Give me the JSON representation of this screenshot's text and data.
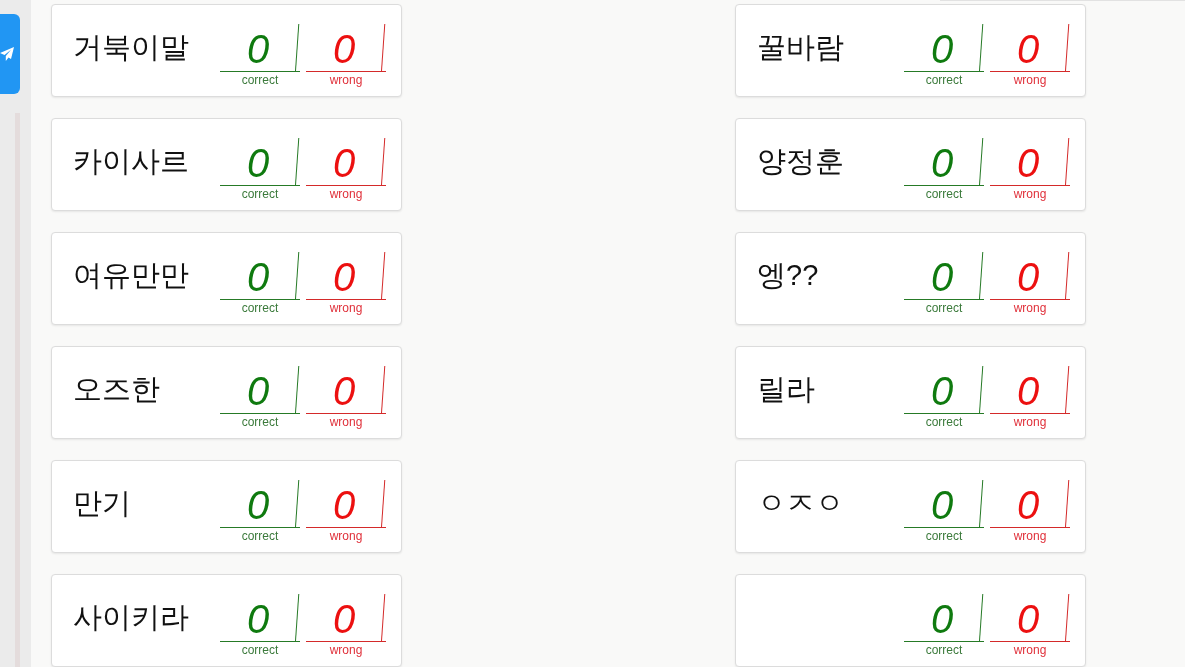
{
  "players": [
    {
      "name": "거북이말",
      "scores": [
        {
          "kind": "correct",
          "value": "0",
          "label": "correct"
        },
        {
          "kind": "wrong",
          "value": "0",
          "label": "wrong"
        }
      ]
    },
    {
      "name": "꿀바람",
      "scores": [
        {
          "kind": "correct",
          "value": "0",
          "label": "correct"
        },
        {
          "kind": "wrong",
          "value": "0",
          "label": "wrong"
        }
      ]
    },
    {
      "name": "카이사르",
      "scores": [
        {
          "kind": "correct",
          "value": "0",
          "label": "correct"
        },
        {
          "kind": "wrong",
          "value": "0",
          "label": "wrong"
        }
      ]
    },
    {
      "name": "양정훈",
      "scores": [
        {
          "kind": "correct",
          "value": "0",
          "label": "correct"
        },
        {
          "kind": "wrong",
          "value": "0",
          "label": "wrong"
        }
      ]
    },
    {
      "name": "여유만만",
      "scores": [
        {
          "kind": "correct",
          "value": "0",
          "label": "correct"
        },
        {
          "kind": "wrong",
          "value": "0",
          "label": "wrong"
        }
      ]
    },
    {
      "name": "엥??",
      "scores": [
        {
          "kind": "correct",
          "value": "0",
          "label": "correct"
        },
        {
          "kind": "wrong",
          "value": "0",
          "label": "wrong"
        }
      ]
    },
    {
      "name": "오즈한",
      "scores": [
        {
          "kind": "correct",
          "value": "0",
          "label": "correct"
        },
        {
          "kind": "wrong",
          "value": "0",
          "label": "wrong"
        }
      ]
    },
    {
      "name": "릴라",
      "scores": [
        {
          "kind": "correct",
          "value": "0",
          "label": "correct"
        },
        {
          "kind": "wrong",
          "value": "0",
          "label": "wrong"
        }
      ]
    },
    {
      "name": "만기",
      "scores": [
        {
          "kind": "correct",
          "value": "0",
          "label": "correct"
        },
        {
          "kind": "wrong",
          "value": "0",
          "label": "wrong"
        }
      ]
    },
    {
      "name": "ㅇㅈㅇ",
      "scores": [
        {
          "kind": "correct",
          "value": "0",
          "label": "correct"
        },
        {
          "kind": "wrong",
          "value": "0",
          "label": "wrong"
        }
      ]
    },
    {
      "name": "사이키라",
      "scores": [
        {
          "kind": "correct",
          "value": "0",
          "label": "correct"
        },
        {
          "kind": "wrong",
          "value": "0",
          "label": "wrong"
        }
      ]
    },
    {
      "scores": [
        {
          "kind": "correct",
          "value": "0",
          "label": "correct"
        },
        {
          "kind": "wrong",
          "value": "0",
          "label": "wrong"
        }
      ]
    }
  ]
}
